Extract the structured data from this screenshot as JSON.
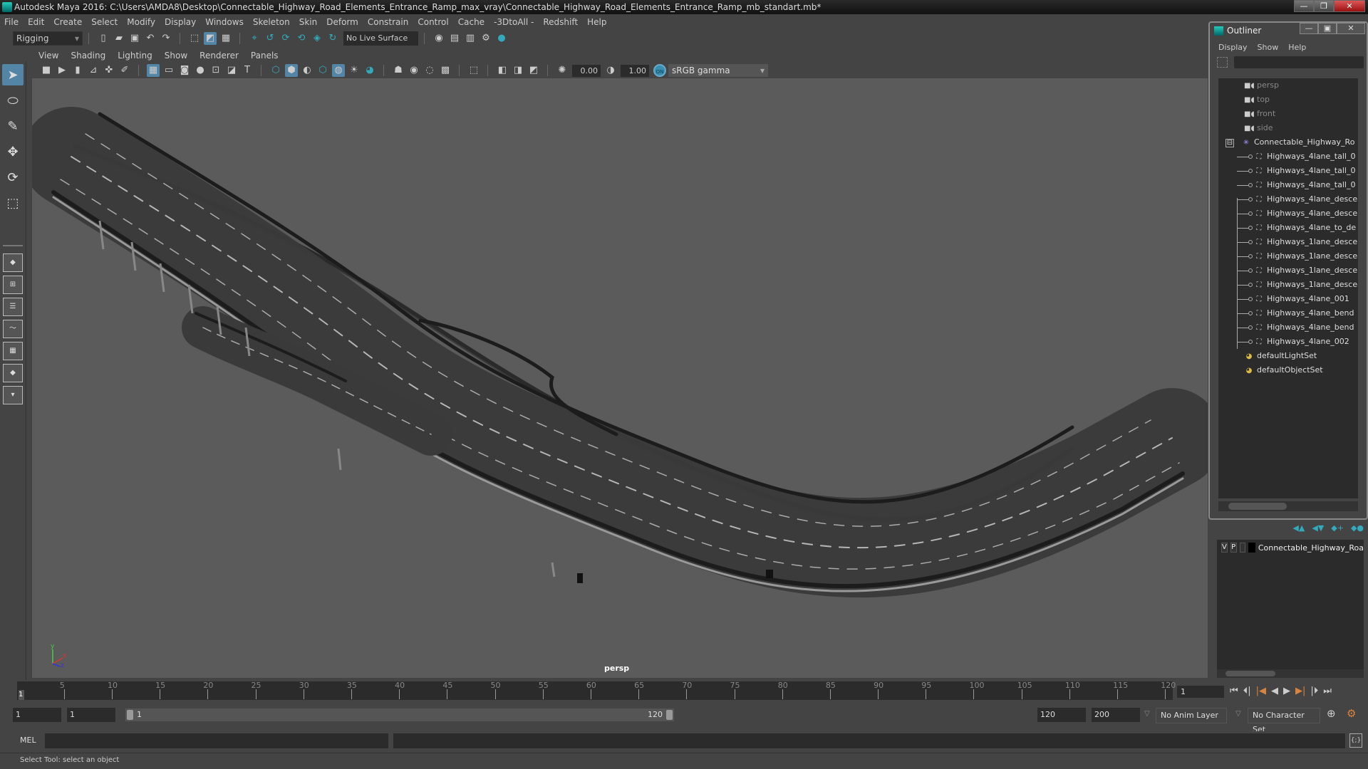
{
  "window": {
    "title": "Autodesk Maya 2016: C:\\Users\\AMDA8\\Desktop\\Connectable_Highway_Road_Elements_Entrance_Ramp_max_vray\\Connectable_Highway_Road_Elements_Entrance_Ramp_mb_standart.mb*",
    "controls": {
      "minimize": "—",
      "restore": "❐",
      "close": "✕"
    }
  },
  "menubar": [
    "File",
    "Edit",
    "Create",
    "Select",
    "Modify",
    "Display",
    "Windows",
    "Skeleton",
    "Skin",
    "Deform",
    "Constrain",
    "Control",
    "Cache",
    "-3DtoAll -",
    "Redshift",
    "Help"
  ],
  "shelf": {
    "mode": "Rigging",
    "live_surface": "No Live Surface"
  },
  "panel": {
    "menu": [
      "View",
      "Shading",
      "Lighting",
      "Show",
      "Renderer",
      "Panels"
    ],
    "exposure": "0.00",
    "gamma_value": "1.00",
    "color_mgmt_toggle": "ON",
    "color_space": "sRGB gamma",
    "camera_label": "persp",
    "axis": {
      "x": "x",
      "y": "y",
      "z": "z"
    }
  },
  "outliner": {
    "title": "Outliner",
    "menu": [
      "Display",
      "Show",
      "Help"
    ],
    "items": [
      {
        "label": "persp",
        "type": "camera"
      },
      {
        "label": "top",
        "type": "camera"
      },
      {
        "label": "front",
        "type": "camera"
      },
      {
        "label": "side",
        "type": "camera"
      },
      {
        "label": "Connectable_Highway_Ro",
        "type": "group",
        "expanded": true
      },
      {
        "label": "Highways_4lane_tall_0",
        "type": "mesh"
      },
      {
        "label": "Highways_4lane_tall_0",
        "type": "mesh"
      },
      {
        "label": "Highways_4lane_tall_0",
        "type": "mesh"
      },
      {
        "label": "Highways_4lane_desce",
        "type": "mesh"
      },
      {
        "label": "Highways_4lane_desce",
        "type": "mesh"
      },
      {
        "label": "Highways_4lane_to_de",
        "type": "mesh"
      },
      {
        "label": "Highways_1lane_desce",
        "type": "mesh"
      },
      {
        "label": "Highways_1lane_desce",
        "type": "mesh"
      },
      {
        "label": "Highways_1lane_desce",
        "type": "mesh"
      },
      {
        "label": "Highways_1lane_desce",
        "type": "mesh"
      },
      {
        "label": "Highways_4lane_001",
        "type": "mesh"
      },
      {
        "label": "Highways_4lane_bend",
        "type": "mesh"
      },
      {
        "label": "Highways_4lane_bend",
        "type": "mesh"
      },
      {
        "label": "Highways_4lane_002",
        "type": "mesh"
      },
      {
        "label": "defaultLightSet",
        "type": "set"
      },
      {
        "label": "defaultObjectSet",
        "type": "set"
      }
    ]
  },
  "layers": {
    "rows": [
      {
        "v": "V",
        "p": "P",
        "name": "Connectable_Highway_Roa",
        "color": "#000000"
      }
    ]
  },
  "timeline": {
    "ticks": [
      "5",
      "10",
      "15",
      "20",
      "25",
      "30",
      "35",
      "40",
      "45",
      "50",
      "55",
      "60",
      "65",
      "70",
      "75",
      "80",
      "85",
      "90",
      "95",
      "100",
      "105",
      "110",
      "115",
      "120"
    ],
    "current_frame_marker": "1",
    "current_frame": "1"
  },
  "range": {
    "start": "1",
    "playback_start": "1",
    "slider_start": "1",
    "slider_end": "120",
    "playback_end": "120",
    "end": "200",
    "anim_layer": "No Anim Layer",
    "character_set": "No Character Set"
  },
  "command": {
    "label": "MEL"
  },
  "status": {
    "text": "Select Tool: select an object"
  },
  "colors": {
    "accent": "#5285a6",
    "viewport_bg": "#5b5b5b",
    "keyframe": "#d8843e"
  }
}
